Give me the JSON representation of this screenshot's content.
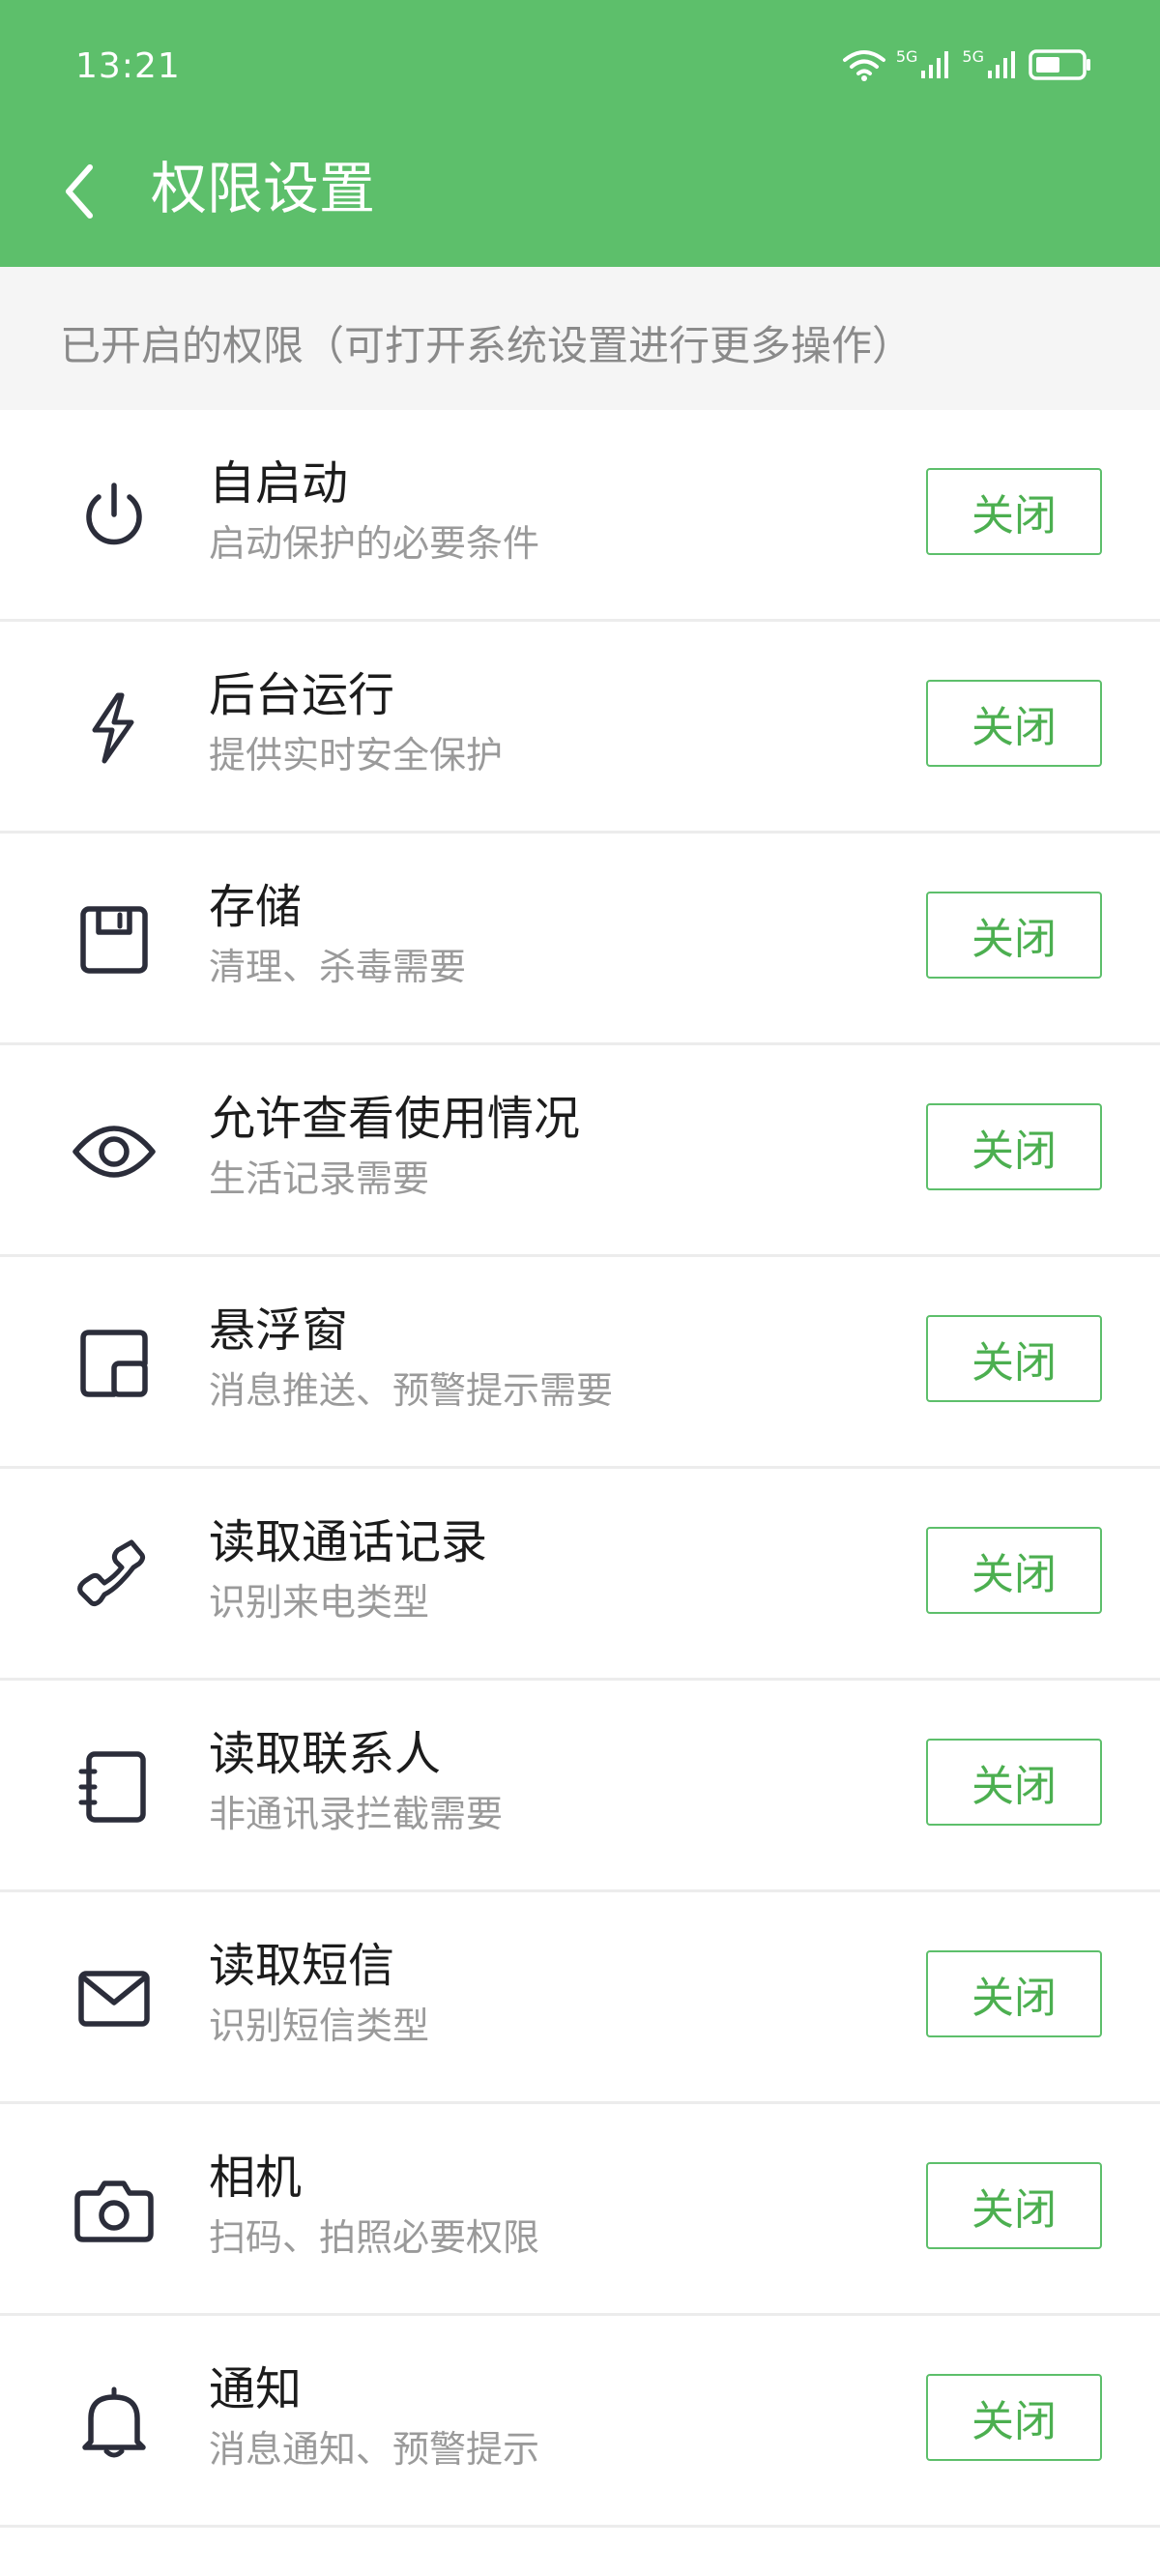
{
  "status_bar": {
    "time": "13:21",
    "network_1": "5G",
    "network_2": "5G",
    "icons": [
      "wifi-icon",
      "signal-icon",
      "signal-icon",
      "battery-icon"
    ]
  },
  "header": {
    "title": "权限设置",
    "back_icon": "chevron-left-icon",
    "color": "#5dbf6b"
  },
  "notice": {
    "text": "已开启的权限（可打开系统设置进行更多操作）"
  },
  "permissions": [
    {
      "icon": "power-icon",
      "title": "自启动",
      "subtitle": "启动保护的必要条件",
      "button": "关闭"
    },
    {
      "icon": "lightning-icon",
      "title": "后台运行",
      "subtitle": "提供实时安全保护",
      "button": "关闭"
    },
    {
      "icon": "floppy-disk-icon",
      "title": "存储",
      "subtitle": "清理、杀毒需要",
      "button": "关闭"
    },
    {
      "icon": "eye-icon",
      "title": "允许查看使用情况",
      "subtitle": "生活记录需要",
      "button": "关闭"
    },
    {
      "icon": "floating-window-icon",
      "title": "悬浮窗",
      "subtitle": "消息推送、预警提示需要",
      "button": "关闭"
    },
    {
      "icon": "phone-icon",
      "title": "读取通话记录",
      "subtitle": "识别来电类型",
      "button": "关闭"
    },
    {
      "icon": "contacts-book-icon",
      "title": "读取联系人",
      "subtitle": "非通讯录拦截需要",
      "button": "关闭"
    },
    {
      "icon": "envelope-icon",
      "title": "读取短信",
      "subtitle": "识别短信类型",
      "button": "关闭"
    },
    {
      "icon": "camera-icon",
      "title": "相机",
      "subtitle": "扫码、拍照必要权限",
      "button": "关闭"
    },
    {
      "icon": "bell-icon",
      "title": "通知",
      "subtitle": "消息通知、预警提示",
      "button": "关闭"
    }
  ],
  "colors": {
    "accent": "#5dbf6b",
    "button_text": "#4caf50",
    "subtitle": "#9a9a9a",
    "notice_bg": "#f5f5f5"
  }
}
